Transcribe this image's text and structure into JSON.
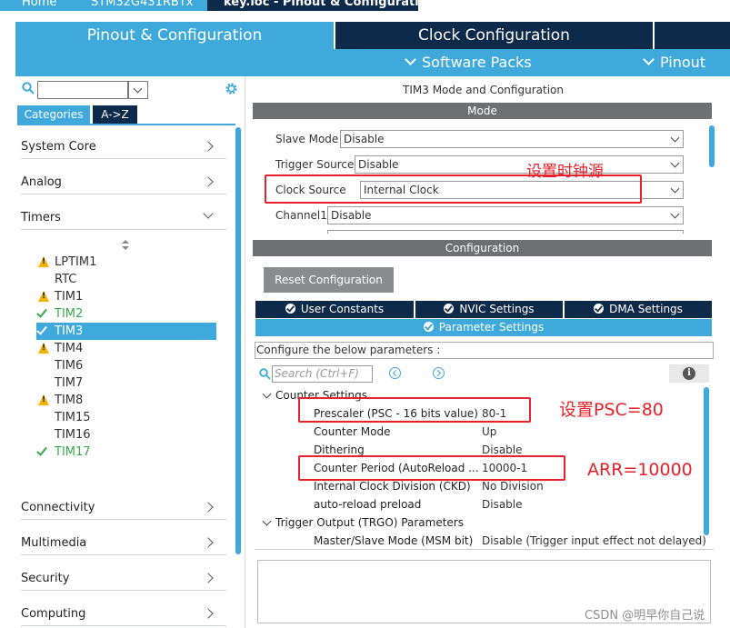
{
  "colors": {
    "accent": "#3fa9dc",
    "dark_navy": "#0e2a4a",
    "header_gray": "#6d6f72",
    "annotation_red": "#e8212a",
    "ok_green": "#3aa84a",
    "warn_yellow": "#f0b400"
  },
  "breadcrumb": {
    "items": [
      "Home",
      "STM32G431RBTx",
      "key.ioc - Pinout & Configuration"
    ]
  },
  "main_tabs": {
    "pinout": "Pinout & Configuration",
    "clock": "Clock Configuration"
  },
  "subbar": {
    "software_packs": "Software Packs",
    "pinout": "Pinout"
  },
  "left": {
    "search": {
      "value": "",
      "icon": "search-icon"
    },
    "settings_icon": "gear-icon",
    "tabs": [
      "Categories",
      "A->Z"
    ],
    "categories": {
      "system_core": "System Core",
      "analog": "Analog",
      "timers": "Timers",
      "connectivity": "Connectivity",
      "multimedia": "Multimedia",
      "security": "Security",
      "computing": "Computing"
    },
    "timers": [
      {
        "name": "LPTIM1",
        "status": "warning"
      },
      {
        "name": "RTC",
        "status": "none"
      },
      {
        "name": "TIM1",
        "status": "warning"
      },
      {
        "name": "TIM2",
        "status": "ok"
      },
      {
        "name": "TIM3",
        "status": "selected"
      },
      {
        "name": "TIM4",
        "status": "warning"
      },
      {
        "name": "TIM6",
        "status": "none"
      },
      {
        "name": "TIM7",
        "status": "none"
      },
      {
        "name": "TIM8",
        "status": "warning"
      },
      {
        "name": "TIM15",
        "status": "none"
      },
      {
        "name": "TIM16",
        "status": "none"
      },
      {
        "name": "TIM17",
        "status": "ok"
      }
    ]
  },
  "right": {
    "title": "TIM3 Mode and Configuration",
    "mode_header": "Mode",
    "mode": {
      "slave_mode": {
        "label": "Slave Mode",
        "value": "Disable"
      },
      "trigger_source": {
        "label": "Trigger Source",
        "value": "Disable"
      },
      "clock_source": {
        "label": "Clock Source",
        "value": "Internal Clock"
      },
      "channel1": {
        "label": "Channel1",
        "value": "Disable"
      }
    },
    "configuration_header": "Configuration",
    "reset_button": "Reset Configuration",
    "config_tabs": {
      "user_constants": "User Constants",
      "nvic": "NVIC Settings",
      "dma": "DMA Settings",
      "parameter": "Parameter Settings"
    },
    "configure_label": "Configure the below parameters :",
    "param_search_placeholder": "Search (Ctrl+F)",
    "groups": {
      "counter": "Counter Settings",
      "trgo": "Trigger Output (TRGO) Parameters"
    },
    "params": {
      "prescaler": {
        "name": "Prescaler (PSC - 16 bits value)",
        "value": "80-1"
      },
      "counter_mode": {
        "name": "Counter Mode",
        "value": "Up"
      },
      "dithering": {
        "name": "Dithering",
        "value": "Disable"
      },
      "period": {
        "name": "Counter Period (AutoReload ...",
        "value": "10000-1"
      },
      "ckd": {
        "name": "Internal Clock Division (CKD)",
        "value": "No Division"
      },
      "preload": {
        "name": "auto-reload preload",
        "value": "Disable"
      },
      "msm": {
        "name": "Master/Slave Mode (MSM bit)",
        "value": "Disable (Trigger input effect not delayed)"
      }
    }
  },
  "annotations": {
    "clock": "设置时钟源",
    "psc": "设置PSC=80",
    "arr": "ARR=10000"
  },
  "watermark": "CSDN @明早你自己说"
}
